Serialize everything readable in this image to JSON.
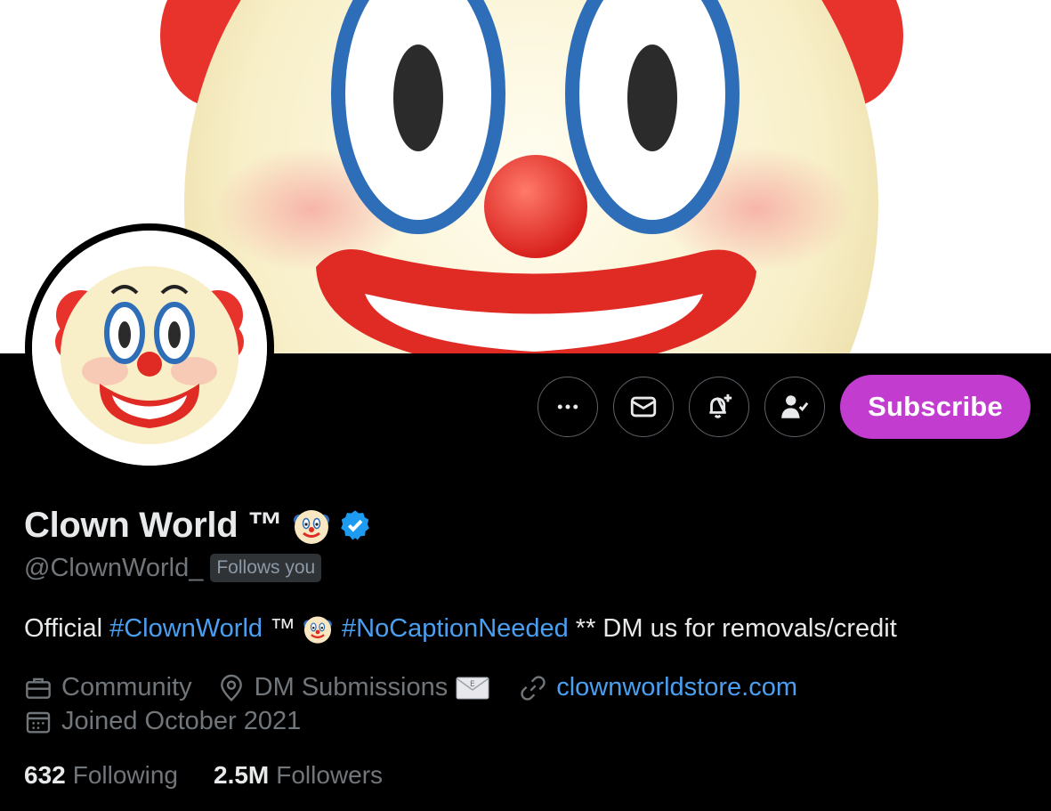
{
  "profile": {
    "display_name": "Clown World ™",
    "handle": "@ClownWorld_",
    "follows_you": "Follows you",
    "verified": true
  },
  "actions": {
    "more": "more-options",
    "message": "message",
    "notify": "notifications",
    "following_state": "following",
    "subscribe_label": "Subscribe",
    "subscribe_color": "#c13ccf"
  },
  "bio": {
    "prefix": "Official",
    "hashtag1": "#ClownWorld",
    "tm": "™",
    "hashtag2": "#NoCaptionNeeded",
    "suffix": "** DM us for removals/credit"
  },
  "meta": {
    "category": "Community",
    "location": "DM Submissions",
    "website": "clownworldstore.com",
    "joined": "Joined October 2021"
  },
  "stats": {
    "following_count": "632",
    "following_label": "Following",
    "followers_count": "2.5M",
    "followers_label": "Followers"
  },
  "colors": {
    "link": "#4a9ff0",
    "muted": "#71767b",
    "text": "#e7e9ea",
    "background": "#000000",
    "verified": "#1d9bf0"
  }
}
